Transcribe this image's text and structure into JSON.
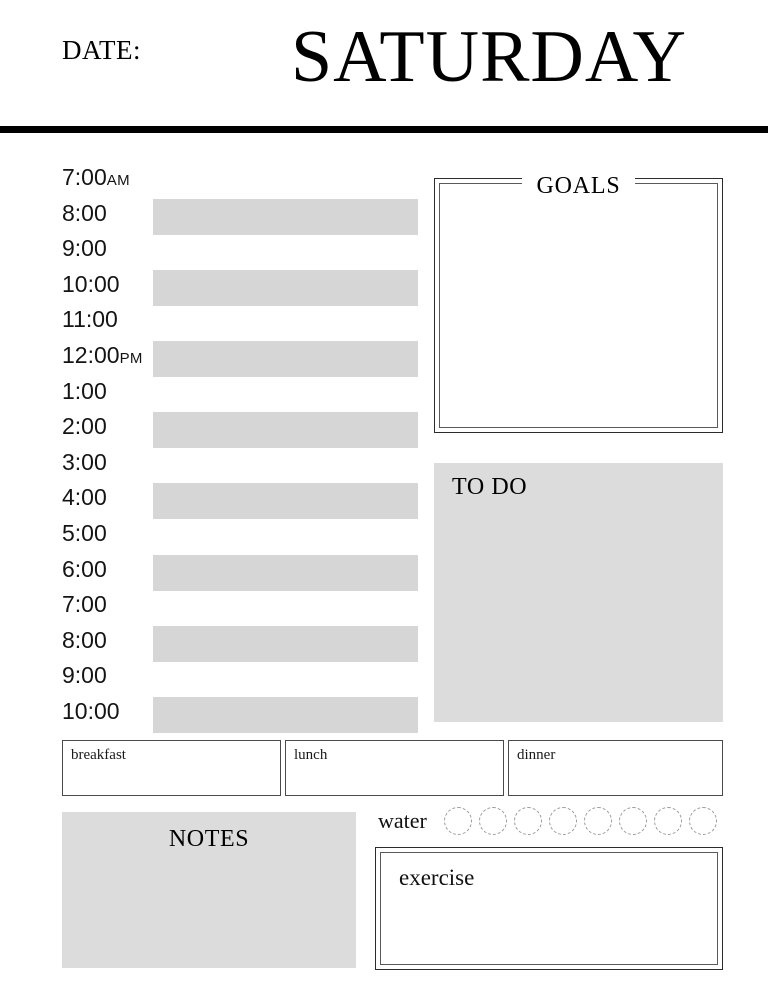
{
  "header": {
    "date_label": "DATE:",
    "day_title": "SATURDAY"
  },
  "schedule": {
    "slots": [
      {
        "time": "7:00",
        "ampm": "AM",
        "bar": false
      },
      {
        "time": "8:00",
        "ampm": "",
        "bar": true
      },
      {
        "time": "9:00",
        "ampm": "",
        "bar": false
      },
      {
        "time": "10:00",
        "ampm": "",
        "bar": true
      },
      {
        "time": "11:00",
        "ampm": "",
        "bar": false
      },
      {
        "time": "12:00",
        "ampm": "PM",
        "bar": true
      },
      {
        "time": "1:00",
        "ampm": "",
        "bar": false
      },
      {
        "time": "2:00",
        "ampm": "",
        "bar": true
      },
      {
        "time": "3:00",
        "ampm": "",
        "bar": false
      },
      {
        "time": "4:00",
        "ampm": "",
        "bar": true
      },
      {
        "time": "5:00",
        "ampm": "",
        "bar": false
      },
      {
        "time": "6:00",
        "ampm": "",
        "bar": true
      },
      {
        "time": "7:00",
        "ampm": "",
        "bar": false
      },
      {
        "time": "8:00",
        "ampm": "",
        "bar": true
      },
      {
        "time": "9:00",
        "ampm": "",
        "bar": false
      },
      {
        "time": "10:00",
        "ampm": "",
        "bar": true
      }
    ]
  },
  "goals": {
    "title": "GOALS"
  },
  "todo": {
    "title": "TO DO"
  },
  "meals": [
    {
      "key": "breakfast",
      "label": "breakfast"
    },
    {
      "key": "lunch",
      "label": "lunch"
    },
    {
      "key": "dinner",
      "label": "dinner"
    }
  ],
  "water": {
    "label": "water",
    "count": 8,
    "filled": 0
  },
  "notes": {
    "title": "NOTES"
  },
  "exercise": {
    "label": "exercise"
  },
  "colors": {
    "bar_fill": "#d6d6d6",
    "panel_fill": "#dcdcdc",
    "rule": "#000000",
    "border_outer": "#2b2b2b",
    "border_inner": "#5a5a5a",
    "circle_border": "#9a9a9a"
  }
}
